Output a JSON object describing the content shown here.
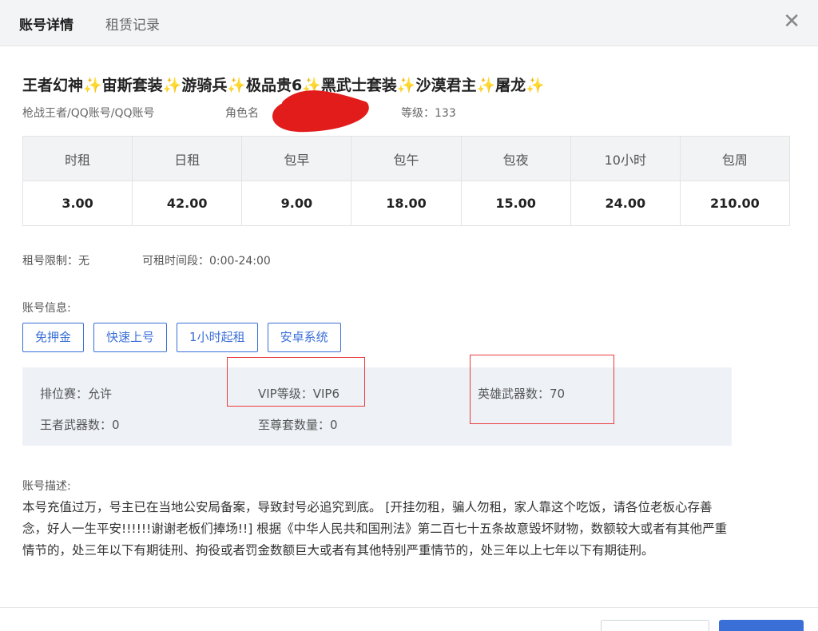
{
  "tabs": {
    "detail": "账号详情",
    "records": "租赁记录"
  },
  "close_icon": "close-icon",
  "title": "王者幻神✨宙斯套装✨游骑兵✨极品贵6✨黑武士套装✨沙漠君主✨屠龙✨",
  "subinfo": {
    "platform": "枪战王者/QQ账号/QQ账号",
    "role_label": "角色名",
    "level": "等级：133"
  },
  "pricing": {
    "headers": [
      "时租",
      "日租",
      "包早",
      "包午",
      "包夜",
      "10小时",
      "包周"
    ],
    "values": [
      "3.00",
      "42.00",
      "9.00",
      "18.00",
      "15.00",
      "24.00",
      "210.00"
    ]
  },
  "limits": {
    "restriction": "租号限制：无",
    "time_window": "可租时间段：0:00-24:00"
  },
  "account_info": {
    "label": "账号信息:",
    "tags": [
      "免押金",
      "快速上号",
      "1小时起租",
      "安卓系统"
    ],
    "ranked": "排位赛：允许",
    "vip": "VIP等级：VIP6",
    "hero_weapons": "英雄武器数：70",
    "king_weapons": "王者武器数：0",
    "supreme_sets": "至尊套数量：0"
  },
  "description": {
    "label": "账号描述:",
    "text": "本号充值过万，号主已在当地公安局备案，导致封号必追究到底。 [开挂勿租，骗人勿租，家人靠这个吃饭，请各位老板心存善念，好人一生平安!!!!!!谢谢老板们捧场!!] 根据《中华人民共和国刑法》第二百七十五条故意毁坏财物，数额较大或者有其他严重情节的，处三年以下有期徒刑、拘役或者罚金数额巨大或者有其他特别严重情节的，处三年以上七年以下有期徒刑。"
  },
  "colors": {
    "accent": "#3b6fd8",
    "highlight": "#e83a3a"
  }
}
